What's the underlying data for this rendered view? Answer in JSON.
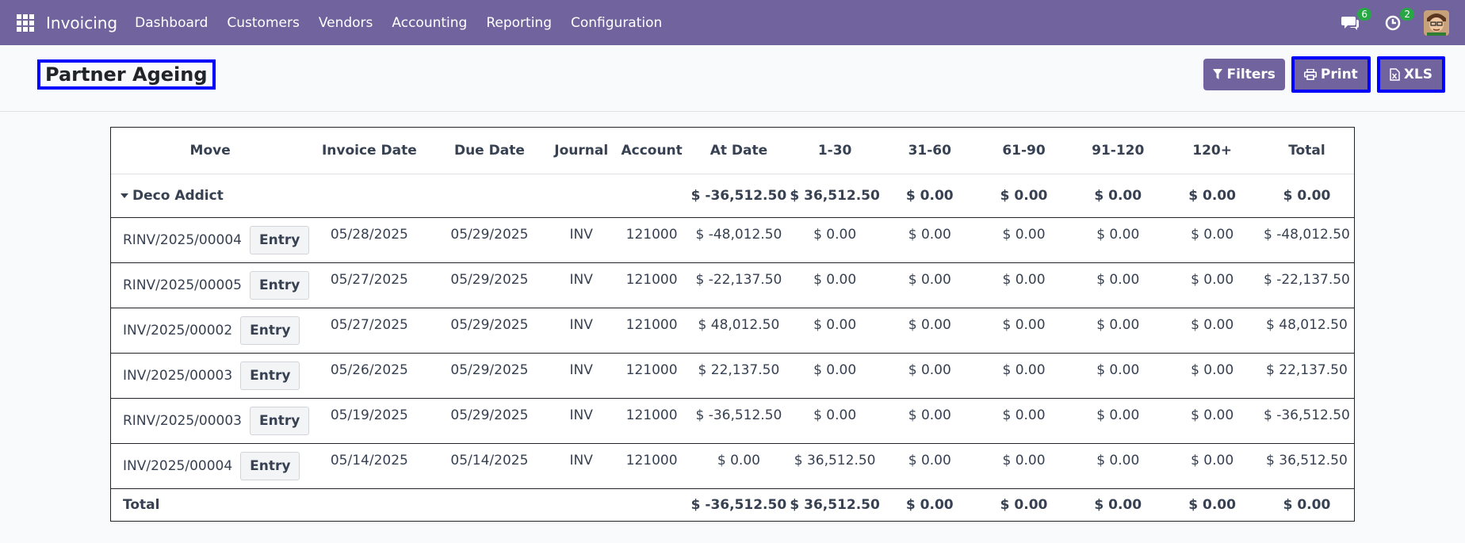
{
  "navbar": {
    "app_name": "Invoicing",
    "menu": [
      "Dashboard",
      "Customers",
      "Vendors",
      "Accounting",
      "Reporting",
      "Configuration"
    ],
    "messages_badge": "6",
    "activities_badge": "2"
  },
  "page": {
    "title": "Partner Ageing",
    "buttons": {
      "filters": "Filters",
      "print": "Print",
      "xls": "XLS"
    }
  },
  "table": {
    "headers": [
      "Move",
      "Invoice Date",
      "Due Date",
      "Journal",
      "Account",
      "At Date",
      "1-30",
      "31-60",
      "61-90",
      "91-120",
      "120+",
      "Total"
    ],
    "partner": {
      "name": "Deco Addict",
      "at_date": "$ -36,512.50",
      "d1_30": "$ 36,512.50",
      "d31_60": "$ 0.00",
      "d61_90": "$ 0.00",
      "d91_120": "$ 0.00",
      "d120p": "$ 0.00",
      "total": "$ 0.00"
    },
    "entry_label": "Entry",
    "rows": [
      {
        "move": "RINV/2025/00004",
        "invoice_date": "05/28/2025",
        "due_date": "05/29/2025",
        "journal": "INV",
        "account": "121000",
        "at_date": "$ -48,012.50",
        "d1_30": "$ 0.00",
        "d31_60": "$ 0.00",
        "d61_90": "$ 0.00",
        "d91_120": "$ 0.00",
        "d120p": "$ 0.00",
        "total": "$ -48,012.50"
      },
      {
        "move": "RINV/2025/00005",
        "invoice_date": "05/27/2025",
        "due_date": "05/29/2025",
        "journal": "INV",
        "account": "121000",
        "at_date": "$ -22,137.50",
        "d1_30": "$ 0.00",
        "d31_60": "$ 0.00",
        "d61_90": "$ 0.00",
        "d91_120": "$ 0.00",
        "d120p": "$ 0.00",
        "total": "$ -22,137.50"
      },
      {
        "move": "INV/2025/00002",
        "invoice_date": "05/27/2025",
        "due_date": "05/29/2025",
        "journal": "INV",
        "account": "121000",
        "at_date": "$ 48,012.50",
        "d1_30": "$ 0.00",
        "d31_60": "$ 0.00",
        "d61_90": "$ 0.00",
        "d91_120": "$ 0.00",
        "d120p": "$ 0.00",
        "total": "$ 48,012.50"
      },
      {
        "move": "INV/2025/00003",
        "invoice_date": "05/26/2025",
        "due_date": "05/29/2025",
        "journal": "INV",
        "account": "121000",
        "at_date": "$ 22,137.50",
        "d1_30": "$ 0.00",
        "d31_60": "$ 0.00",
        "d61_90": "$ 0.00",
        "d91_120": "$ 0.00",
        "d120p": "$ 0.00",
        "total": "$ 22,137.50"
      },
      {
        "move": "RINV/2025/00003",
        "invoice_date": "05/19/2025",
        "due_date": "05/29/2025",
        "journal": "INV",
        "account": "121000",
        "at_date": "$ -36,512.50",
        "d1_30": "$ 0.00",
        "d31_60": "$ 0.00",
        "d61_90": "$ 0.00",
        "d91_120": "$ 0.00",
        "d120p": "$ 0.00",
        "total": "$ -36,512.50"
      },
      {
        "move": "INV/2025/00004",
        "invoice_date": "05/14/2025",
        "due_date": "05/14/2025",
        "journal": "INV",
        "account": "121000",
        "at_date": "$ 0.00",
        "d1_30": "$ 36,512.50",
        "d31_60": "$ 0.00",
        "d61_90": "$ 0.00",
        "d91_120": "$ 0.00",
        "d120p": "$ 0.00",
        "total": "$ 36,512.50"
      }
    ],
    "total": {
      "label": "Total",
      "at_date": "$ -36,512.50",
      "d1_30": "$ 36,512.50",
      "d31_60": "$ 0.00",
      "d61_90": "$ 0.00",
      "d91_120": "$ 0.00",
      "d120p": "$ 0.00",
      "total": "$ 0.00"
    }
  }
}
